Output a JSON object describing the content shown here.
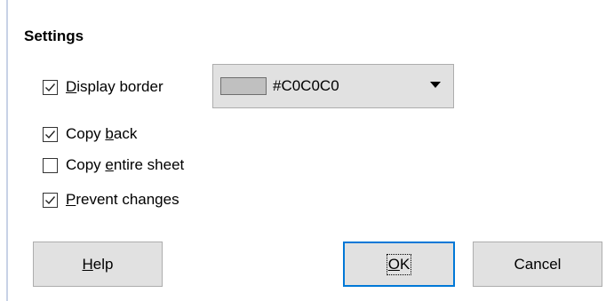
{
  "settings": {
    "title": "Settings"
  },
  "checkboxes": {
    "display_border": {
      "label_pre": "",
      "label_mnemonic": "D",
      "label_post": "isplay border",
      "checked": true
    },
    "copy_back": {
      "label_pre": "Copy ",
      "label_mnemonic": "b",
      "label_post": "ack",
      "checked": true
    },
    "copy_entire_sheet": {
      "label_pre": "Copy ",
      "label_mnemonic": "e",
      "label_post": "ntire sheet",
      "checked": false
    },
    "prevent_changes": {
      "label_pre": "",
      "label_mnemonic": "P",
      "label_post": "revent changes",
      "checked": true
    }
  },
  "border_color": {
    "value": "#C0C0C0",
    "swatch_color": "#c0c0c0"
  },
  "buttons": {
    "help_mnemonic": "H",
    "help_rest": "elp",
    "ok_mnemonic": "O",
    "ok_rest": "K",
    "cancel": "Cancel"
  },
  "colors": {
    "focus_accent": "#0078d7",
    "button_face": "#e1e1e1"
  }
}
